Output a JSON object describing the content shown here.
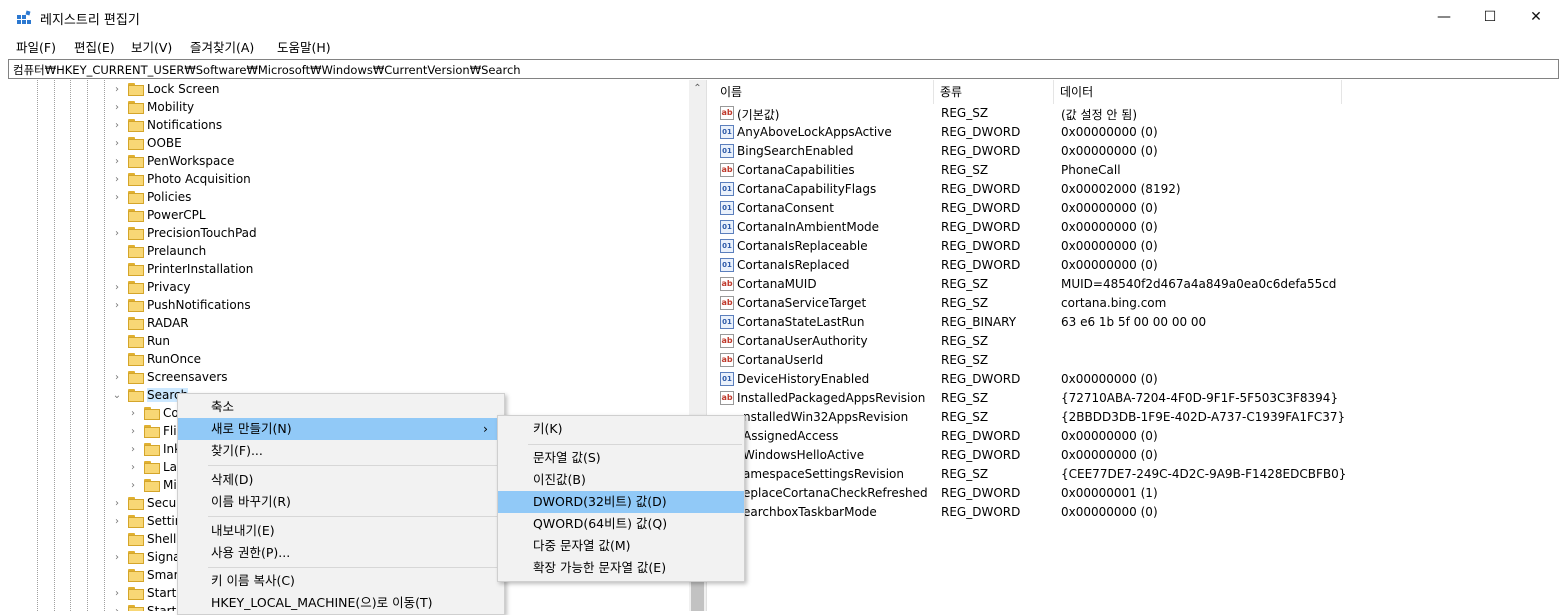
{
  "window": {
    "title": "레지스트리 편집기",
    "minimize": "—",
    "maximize": "☐",
    "close": "✕"
  },
  "menu": [
    "파일(F)",
    "편집(E)",
    "보기(V)",
    "즐겨찾기(A)",
    "도움말(H)"
  ],
  "address": "컴퓨터₩HKEY_CURRENT_USER₩Software₩Microsoft₩Windows₩CurrentVersion₩Search",
  "tree": {
    "items": [
      "Lock Screen",
      "Mobility",
      "Notifications",
      "OOBE",
      "PenWorkspace",
      "Photo Acquisition",
      "Policies",
      "PowerCPL",
      "PrecisionTouchPad",
      "Prelaunch",
      "PrinterInstallation",
      "Privacy",
      "PushNotifications",
      "RADAR",
      "Run",
      "RunOnce",
      "Screensavers",
      "Search",
      "Co",
      "Fli",
      "Ink",
      "La",
      "Mi",
      "Secur",
      "Settin",
      "Shell",
      "Signa",
      "Smar",
      "StartL",
      "Start"
    ]
  },
  "list": {
    "headers": {
      "name": "이름",
      "type": "종류",
      "data": "데이터"
    },
    "rows": [
      {
        "name": "(기본값)",
        "type": "REG_SZ",
        "data": "(값 설정 안 됨)",
        "icon": "string-value-icon"
      },
      {
        "name": "AnyAboveLockAppsActive",
        "type": "REG_DWORD",
        "data": "0x00000000 (0)",
        "icon": "binary-value-icon"
      },
      {
        "name": "BingSearchEnabled",
        "type": "REG_DWORD",
        "data": "0x00000000 (0)",
        "icon": "binary-value-icon"
      },
      {
        "name": "CortanaCapabilities",
        "type": "REG_SZ",
        "data": "PhoneCall",
        "icon": "string-value-icon"
      },
      {
        "name": "CortanaCapabilityFlags",
        "type": "REG_DWORD",
        "data": "0x00002000 (8192)",
        "icon": "binary-value-icon"
      },
      {
        "name": "CortanaConsent",
        "type": "REG_DWORD",
        "data": "0x00000000 (0)",
        "icon": "binary-value-icon"
      },
      {
        "name": "CortanaInAmbientMode",
        "type": "REG_DWORD",
        "data": "0x00000000 (0)",
        "icon": "binary-value-icon"
      },
      {
        "name": "CortanaIsReplaceable",
        "type": "REG_DWORD",
        "data": "0x00000000 (0)",
        "icon": "binary-value-icon"
      },
      {
        "name": "CortanaIsReplaced",
        "type": "REG_DWORD",
        "data": "0x00000000 (0)",
        "icon": "binary-value-icon"
      },
      {
        "name": "CortanaMUID",
        "type": "REG_SZ",
        "data": "MUID=48540f2d467a4a849a0ea0c6defa55cd",
        "icon": "string-value-icon"
      },
      {
        "name": "CortanaServiceTarget",
        "type": "REG_SZ",
        "data": "cortana.bing.com",
        "icon": "string-value-icon"
      },
      {
        "name": "CortanaStateLastRun",
        "type": "REG_BINARY",
        "data": "63 e6 1b 5f 00 00 00 00",
        "icon": "binary-value-icon"
      },
      {
        "name": "CortanaUserAuthority",
        "type": "REG_SZ",
        "data": "",
        "icon": "string-value-icon"
      },
      {
        "name": "CortanaUserId",
        "type": "REG_SZ",
        "data": "",
        "icon": "string-value-icon"
      },
      {
        "name": "DeviceHistoryEnabled",
        "type": "REG_DWORD",
        "data": "0x00000000 (0)",
        "icon": "binary-value-icon"
      },
      {
        "name": "InstalledPackagedAppsRevision",
        "type": "REG_SZ",
        "data": "{72710ABA-7204-4F0D-9F1F-5F503C3F8394}",
        "icon": "string-value-icon"
      },
      {
        "name": "nstalledWin32AppsRevision",
        "type": "REG_SZ",
        "data": "{2BBDD3DB-1F9E-402D-A737-C1939FA1FC37}",
        "icon": ""
      },
      {
        "name": "AssignedAccess",
        "type": "REG_DWORD",
        "data": "0x00000000 (0)",
        "icon": ""
      },
      {
        "name": "WindowsHelloActive",
        "type": "REG_DWORD",
        "data": "0x00000000 (0)",
        "icon": ""
      },
      {
        "name": "amespaceSettingsRevision",
        "type": "REG_SZ",
        "data": "{CEE77DE7-249C-4D2C-9A9B-F1428EDCBFB0}",
        "icon": ""
      },
      {
        "name": "eplaceCortanaCheckRefreshed",
        "type": "REG_DWORD",
        "data": "0x00000001 (1)",
        "icon": ""
      },
      {
        "name": "earchboxTaskbarMode",
        "type": "REG_DWORD",
        "data": "0x00000000 (0)",
        "icon": ""
      }
    ]
  },
  "context_menu": {
    "items": [
      "축소",
      "새로 만들기(N)",
      "찾기(F)...",
      "삭제(D)",
      "이름 바꾸기(R)",
      "내보내기(E)",
      "사용 권한(P)...",
      "키 이름 복사(C)",
      "HKEY_LOCAL_MACHINE(으)로 이동(T)"
    ],
    "submenu_arrow": "›"
  },
  "submenu": {
    "items": [
      "키(K)",
      "문자열 값(S)",
      "이진값(B)",
      "DWORD(32비트) 값(D)",
      "QWORD(64비트) 값(Q)",
      "다중 문자열 값(M)",
      "확장 가능한 문자열 값(E)"
    ]
  },
  "colors": {
    "highlight": "#91c9f7",
    "folder": "#f8d775"
  }
}
